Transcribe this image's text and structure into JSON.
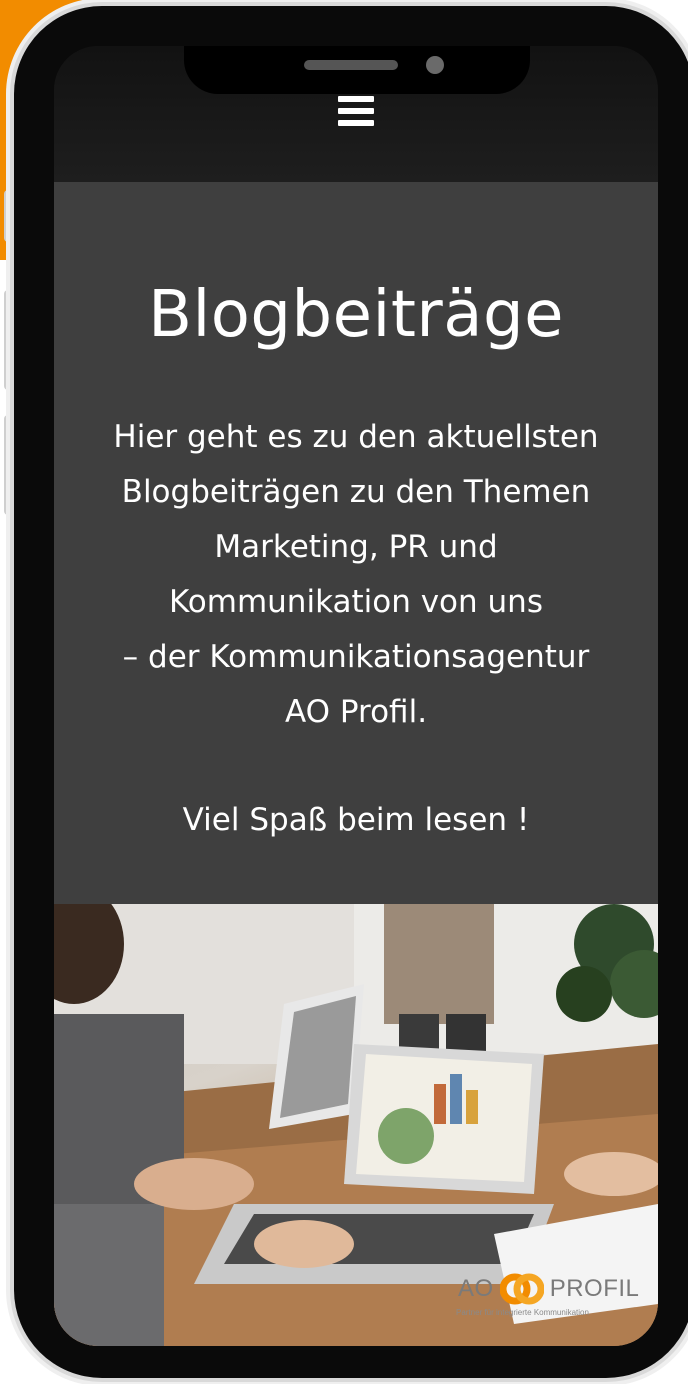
{
  "hero": {
    "title": "Blogbeiträge",
    "intro_lines": [
      "Hier geht es zu den aktuellsten",
      "Blogbeiträgen zu den Themen",
      "Marketing, PR und",
      "Kommunikation von uns",
      "– der Kommunikationsagentur",
      "AO Profil."
    ],
    "cta": "Viel Spaß beim lesen !"
  },
  "logo": {
    "left_text": "AO",
    "right_text": "PROFIL",
    "tagline": "Partner für integrierte Kommunikation"
  },
  "colors": {
    "accent_orange": "#f28c00",
    "hero_background": "#3f3f3f",
    "topbar_background": "#141414",
    "text_light": "#ffffff"
  },
  "icons": {
    "menu": "hamburger-menu-icon"
  }
}
